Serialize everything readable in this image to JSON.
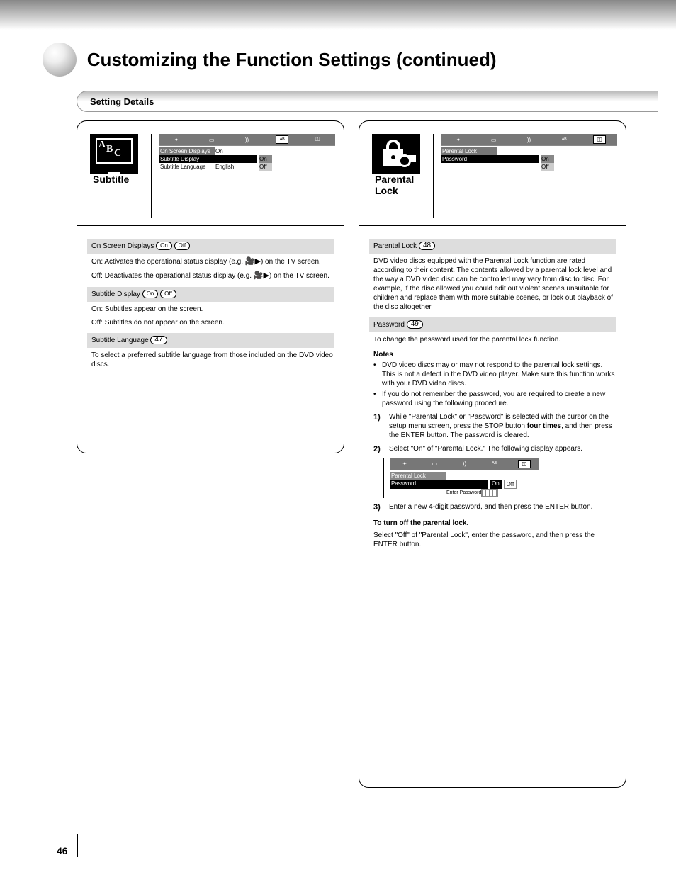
{
  "header": {
    "title": "Customizing the Function Settings (continued)",
    "setting_details": "Setting Details"
  },
  "subtitle_panel": {
    "title": "Subtitle",
    "osd": {
      "row1_label": "On Screen Displays",
      "row1_value": "On",
      "row2_label": "Subtitle Display",
      "row3_label": "Subtitle Language",
      "row3_value": "English",
      "opt_on": "On",
      "opt_off": "Off"
    },
    "sec1": {
      "head_pre": "On Screen Displays ",
      "opt_on": "On",
      "opt_off": "Off",
      "line1a": "On: Activates the operational status display (e.g. ",
      "line1b": ") on the TV screen.",
      "line2a": "Off: Deactivates the operational status display (e.g. ",
      "line2b": ") on the TV screen."
    },
    "sec2": {
      "head_pre": "Subtitle Display ",
      "opt_on": "On",
      "opt_off": "Off",
      "line1": "On: Subtitles appear on the screen.",
      "line2": "Off: Subtitles do not appear on the screen."
    },
    "sec3": {
      "head_pre": "Subtitle Language ",
      "pg_ref": "47",
      "line1": "To select a preferred subtitle language from those included on the DVD video discs."
    }
  },
  "parental_panel": {
    "title": "Parental Lock",
    "osd": {
      "row1_label": "Parental Lock",
      "row2_label": "Password",
      "opt_on": "On",
      "opt_off": "Off"
    },
    "sec1": {
      "head_pre": "Parental Lock ",
      "pg_ref": "48",
      "body": "DVD video discs equipped with the Parental Lock function are rated according to their content. The contents allowed by a parental lock level and the way a DVD video disc can be controlled may vary from disc to disc. For example, if the disc allowed you could edit out violent scenes unsuitable for children and replace them with more suitable scenes, or lock out playback of the disc altogether."
    },
    "sec2": {
      "head_pre": "Password ",
      "pg_ref": "49",
      "body": "To change the password used for the parental lock function.",
      "notes_hd": "Notes",
      "note1": "DVD video discs may or may not respond to the parental lock settings. This is not a defect in the DVD video player. Make sure this function works with your DVD video discs.",
      "note2": "If you do not remember the password, you are required to create a new password using the following procedure.",
      "step1_num": "1)",
      "step1_txt_a": "While \"Parental Lock\" or \"Password\" is selected with the cursor on the setup menu screen, press the STOP button ",
      "step1_txt_b": "four times",
      "step1_txt_c": ", and then press the ENTER button. The password is cleared.",
      "step2_num": "2)",
      "step2_txt": "Select \"On\" of \"Parental Lock.\" The following display appears.",
      "osd2": {
        "row1_label": "Parental Lock",
        "row2_label": "Password",
        "opt_on": "On",
        "opt_off": "Off",
        "enter_label": "Enter Password"
      },
      "step3_num": "3)",
      "step3_txt": "Enter a new 4-digit password, and then press the ENTER button.",
      "to_lbl": "To turn off the parental lock.",
      "to_body": "Select \"Off\" of \"Parental Lock\", enter the password, and then press the ENTER button."
    }
  },
  "page_number": "46"
}
